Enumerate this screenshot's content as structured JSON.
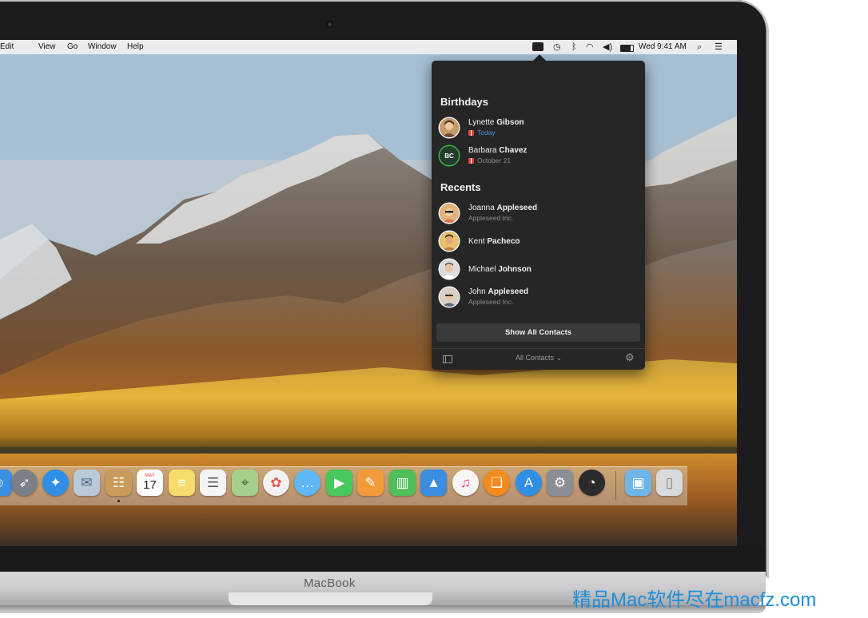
{
  "menubar": {
    "items": [
      "Edit",
      "View",
      "Go",
      "Window",
      "Help"
    ],
    "clock": "Wed 9:41 AM",
    "status_icons": [
      "contacts-menu-icon",
      "time-machine-icon",
      "bluetooth-icon",
      "wifi-icon",
      "volume-icon",
      "battery-icon",
      "spotlight-icon",
      "notification-center-icon"
    ]
  },
  "popover": {
    "birthdays_title": "Birthdays",
    "birthdays": [
      {
        "first": "Lynette",
        "last": "Gibson",
        "detail": "Today"
      },
      {
        "first": "Barbara",
        "last": "Chavez",
        "detail": "October 21",
        "initials": "BC"
      }
    ],
    "recents_title": "Recents",
    "recents": [
      {
        "first": "Joanna",
        "last": "Appleseed",
        "detail": "Appleseed Inc."
      },
      {
        "first": "Kent",
        "last": "Pacheco",
        "detail": ""
      },
      {
        "first": "Michael",
        "last": "Johnson",
        "detail": ""
      },
      {
        "first": "John",
        "last": "Appleseed",
        "detail": "Appleseed Inc."
      }
    ],
    "show_all_label": "Show All Contacts",
    "filter_label": "All Contacts ⌄"
  },
  "dock": {
    "apps": [
      "finder",
      "launchpad",
      "safari",
      "mail-stamp",
      "contacts",
      "calendar",
      "notes",
      "reminders",
      "maps",
      "photos",
      "messages",
      "facetime",
      "pages",
      "numbers",
      "keynote",
      "itunes",
      "ibooks",
      "app-store",
      "system-preferences",
      "dashboard",
      "downloads-folder",
      "trash"
    ],
    "calendar_month": "MAY",
    "calendar_day": "17"
  },
  "device": {
    "brand": "MacBook"
  },
  "watermark": "精品Mac软件尽在macfz.com"
}
